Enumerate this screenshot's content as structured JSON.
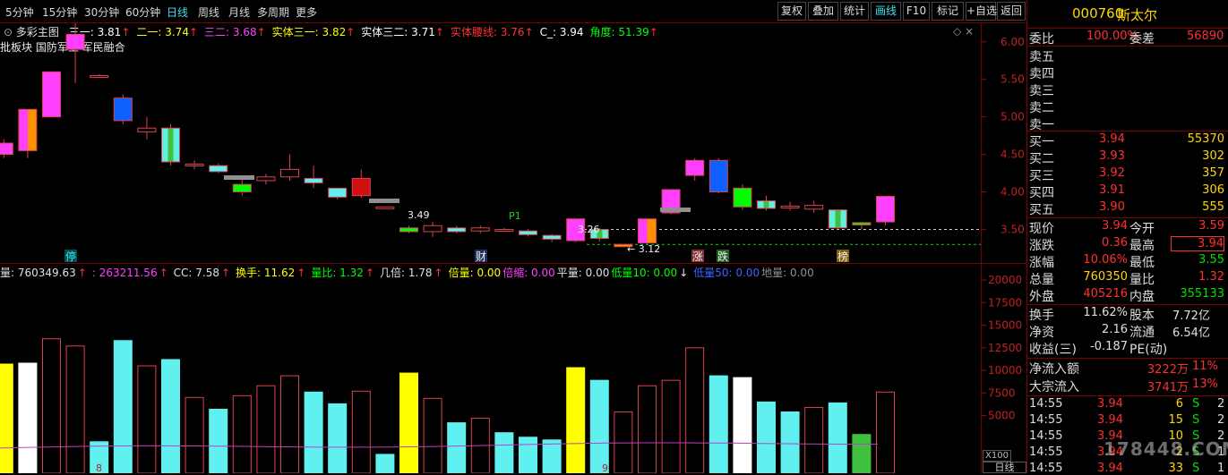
{
  "toolbar": {
    "periods": [
      "5分钟",
      "15分钟",
      "30分钟",
      "60分钟",
      "日线",
      "周线",
      "月线",
      "多周期",
      "更多"
    ],
    "active": "日线",
    "right_buttons": [
      "复权",
      "叠加",
      "统计",
      "画线",
      "F10",
      "标记",
      "+自选",
      "返回"
    ],
    "active_right": "画线"
  },
  "main_legend": {
    "title": "多彩主图",
    "items": [
      {
        "label": "三一: 3.81",
        "arrow": "↑",
        "color": "#ffffff"
      },
      {
        "label": "二一: 3.74",
        "arrow": "↑",
        "color": "#ffff00"
      },
      {
        "label": "三二: 3.68",
        "arrow": "↑",
        "color": "#ff40ff"
      },
      {
        "label": "实体三一: 3.82",
        "arrow": "↑",
        "color": "#ffff00"
      },
      {
        "label": "实体三二: 3.71",
        "arrow": "↑",
        "color": "#ffffff"
      },
      {
        "label": "实体腰线: 3.76",
        "arrow": "↑",
        "color": "#ff3030"
      },
      {
        "label": "C_: 3.94",
        "arrow": "",
        "color": "#ffffff"
      },
      {
        "label": "角度: 51.39",
        "arrow": "↑",
        "color": "#00ff00"
      }
    ],
    "sub": "批板块  国防军工  军民融合"
  },
  "price_axis": [
    "6.00",
    "5.50",
    "5.00",
    "4.50",
    "4.00",
    "3.50"
  ],
  "volume_axis": [
    "20000",
    "17500",
    "15000",
    "12500",
    "10000",
    "7500",
    "5000"
  ],
  "volume_legend": [
    {
      "t": "量: 760349.63",
      "c": "#e0e0e0"
    },
    {
      "t": "↑",
      "c": "#ff3030"
    },
    {
      "t": ": 263211.56",
      "c": "#ff40ff"
    },
    {
      "t": "↑",
      "c": "#ff3030"
    },
    {
      "t": "CC: 7.58",
      "c": "#e0e0e0"
    },
    {
      "t": "↑",
      "c": "#ff3030"
    },
    {
      "t": "换手: 11.62",
      "c": "#ffff00"
    },
    {
      "t": "↑",
      "c": "#ff3030"
    },
    {
      "t": "量比: 1.32",
      "c": "#00ff00"
    },
    {
      "t": "↑",
      "c": "#ff3030"
    },
    {
      "t": "几倍: 1.78",
      "c": "#e0e0e0"
    },
    {
      "t": "↑",
      "c": "#ff3030"
    },
    {
      "t": "倍量: 0.00",
      "c": "#ffff00"
    },
    {
      "t": "倍缩: 0.00",
      "c": "#ff40ff"
    },
    {
      "t": "平量: 0.00",
      "c": "#e0e0e0"
    },
    {
      "t": "低量10: 0.00",
      "c": "#00ff00"
    },
    {
      "t": "↓",
      "c": "#e0e0e0"
    },
    {
      "t": "低量50: 0.00",
      "c": "#4060ff"
    },
    {
      "t": "地量: 0.00",
      "c": "#909090"
    }
  ],
  "chart_labels": {
    "p349": "3.49",
    "p326": "3.26",
    "p312": "← 3.12",
    "p1": "P1",
    "marks": [
      "停",
      "财",
      "涨",
      "跌",
      "榜"
    ],
    "x100": "X100",
    "bottom_tab": "日线",
    "date_marks": [
      "8",
      "9"
    ]
  },
  "quote": {
    "code": "000760",
    "name": "斯太尔",
    "weibi_label": "委比",
    "weibi": "100.00%",
    "weicha_label": "委差",
    "weicha": "56890",
    "sells": [
      {
        "l": "卖五"
      },
      {
        "l": "卖四"
      },
      {
        "l": "卖三"
      },
      {
        "l": "卖二"
      },
      {
        "l": "卖一"
      }
    ],
    "buys": [
      {
        "l": "买一",
        "p": "3.94",
        "v": "55370"
      },
      {
        "l": "买二",
        "p": "3.93",
        "v": "302"
      },
      {
        "l": "买三",
        "p": "3.92",
        "v": "357"
      },
      {
        "l": "买四",
        "p": "3.91",
        "v": "306"
      },
      {
        "l": "买五",
        "p": "3.90",
        "v": "555"
      }
    ],
    "stats": [
      {
        "l1": "现价",
        "v1": "3.94",
        "c1": "#ff3030",
        "l2": "今开",
        "v2": "3.59",
        "c2": "#ff3030"
      },
      {
        "l1": "涨跌",
        "v1": "0.36",
        "c1": "#ff3030",
        "l2": "最高",
        "v2": "3.94",
        "c2": "#ff3030"
      },
      {
        "l1": "涨幅",
        "v1": "10.06%",
        "c1": "#ff3030",
        "l2": "最低",
        "v2": "3.55",
        "c2": "#00e000"
      },
      {
        "l1": "总量",
        "v1": "760350",
        "c1": "#ffd800",
        "l2": "量比",
        "v2": "1.32",
        "c2": "#ff3030"
      },
      {
        "l1": "外盘",
        "v1": "405216",
        "c1": "#ff3030",
        "l2": "内盘",
        "v2": "355133",
        "c2": "#00e000"
      }
    ],
    "stats2": [
      {
        "l1": "换手",
        "v1": "11.62%",
        "l2": "股本",
        "v2": "7.72亿"
      },
      {
        "l1": "净资",
        "v1": "2.16",
        "l2": "流通",
        "v2": "6.54亿"
      },
      {
        "l1": "收益(三)",
        "v1": "-0.187",
        "l2": "PE(动)",
        "v2": ""
      }
    ],
    "flows": [
      {
        "l": "净流入额",
        "v": "3222万",
        "p": "11%"
      },
      {
        "l": "大宗流入",
        "v": "3741万",
        "p": "13%"
      }
    ],
    "ticks": [
      {
        "t": "14:55",
        "p": "3.94",
        "v": "6",
        "s": "S",
        "n": "2"
      },
      {
        "t": "14:55",
        "p": "3.94",
        "v": "15",
        "s": "S",
        "n": "2"
      },
      {
        "t": "14:55",
        "p": "3.94",
        "v": "10",
        "s": "S",
        "n": "2"
      },
      {
        "t": "14:55",
        "p": "3.94",
        "v": "2",
        "s": "S",
        "n": "1"
      },
      {
        "t": "14:55",
        "p": "3.94",
        "v": "33",
        "s": "S",
        "n": "1"
      }
    ]
  },
  "watermark": "178448.COM",
  "chart_data": {
    "type": "candlestick",
    "ylim": [
      3.1,
      6.2
    ],
    "candles": [
      {
        "o": 4.5,
        "c": 4.65,
        "h": 4.7,
        "l": 4.45,
        "f": "#ff40ff"
      },
      {
        "o": 4.55,
        "c": 5.1,
        "h": 5.1,
        "l": 4.45,
        "f": "grad"
      },
      {
        "o": 5.0,
        "c": 5.6,
        "h": 5.6,
        "l": 5.0,
        "f": "#ff40ff"
      },
      {
        "o": 5.9,
        "c": 6.1,
        "h": 6.25,
        "l": 5.45,
        "f": "#ff40ff"
      },
      {
        "o": 5.55,
        "c": 5.55,
        "h": 5.57,
        "l": 5.53,
        "f": "none"
      },
      {
        "o": 5.25,
        "c": 4.95,
        "h": 5.3,
        "l": 4.9,
        "f": "#1060ff"
      },
      {
        "o": 4.8,
        "c": 4.85,
        "h": 5.0,
        "l": 4.7,
        "f": "none"
      },
      {
        "o": 4.85,
        "c": 4.4,
        "h": 4.9,
        "l": 4.35,
        "f": "grad2"
      },
      {
        "o": 4.35,
        "c": 4.37,
        "h": 4.42,
        "l": 4.3,
        "f": "none"
      },
      {
        "o": 4.35,
        "c": 4.27,
        "h": 4.38,
        "l": 4.25,
        "f": "cyan"
      },
      {
        "o": 4.1,
        "c": 4.0,
        "h": 4.2,
        "l": 3.95,
        "f": "#00ff00"
      },
      {
        "o": 4.2,
        "c": 4.15,
        "h": 4.24,
        "l": 4.1,
        "f": "none"
      },
      {
        "o": 4.2,
        "c": 4.3,
        "h": 4.5,
        "l": 4.15,
        "f": "none"
      },
      {
        "o": 4.18,
        "c": 4.12,
        "h": 4.35,
        "l": 4.05,
        "f": "cyan"
      },
      {
        "o": 4.05,
        "c": 3.93,
        "h": 4.05,
        "l": 3.9,
        "f": "cyan"
      },
      {
        "o": 4.18,
        "c": 3.95,
        "h": 4.3,
        "l": 3.92,
        "f": "#d01010"
      },
      {
        "o": 3.8,
        "c": 3.8,
        "h": 3.8,
        "l": 3.8,
        "f": "none"
      },
      {
        "o": 3.52,
        "c": 3.47,
        "h": 3.55,
        "l": 3.45,
        "f": "#00ff00"
      },
      {
        "o": 3.55,
        "c": 3.47,
        "h": 3.6,
        "l": 3.4,
        "f": "none"
      },
      {
        "o": 3.52,
        "c": 3.47,
        "h": 3.55,
        "l": 3.45,
        "f": "cyan"
      },
      {
        "o": 3.52,
        "c": 3.48,
        "h": 3.55,
        "l": 3.45,
        "f": "none"
      },
      {
        "o": 3.5,
        "c": 3.5,
        "h": 3.52,
        "l": 3.48,
        "f": "none"
      },
      {
        "o": 3.48,
        "c": 3.43,
        "h": 3.5,
        "l": 3.41,
        "f": "cyan"
      },
      {
        "o": 3.42,
        "c": 3.37,
        "h": 3.44,
        "l": 3.33,
        "f": "cyan"
      },
      {
        "o": 3.35,
        "c": 3.64,
        "h": 3.64,
        "l": 3.33,
        "f": "#ff40ff"
      },
      {
        "o": 3.5,
        "c": 3.38,
        "h": 3.52,
        "l": 3.34,
        "f": "grad2"
      },
      {
        "o": 3.3,
        "c": 3.27,
        "h": 3.3,
        "l": 3.27,
        "f": "#ff9000"
      },
      {
        "o": 3.32,
        "c": 3.64,
        "h": 3.64,
        "l": 3.3,
        "f": "grad"
      },
      {
        "o": 3.72,
        "c": 4.03,
        "h": 4.03,
        "l": 3.7,
        "f": "#ff40ff"
      },
      {
        "o": 4.22,
        "c": 4.42,
        "h": 4.45,
        "l": 4.15,
        "f": "#ff40ff"
      },
      {
        "o": 4.0,
        "c": 4.42,
        "h": 4.45,
        "l": 3.98,
        "f": "#1060ff"
      },
      {
        "o": 4.05,
        "c": 3.8,
        "h": 4.1,
        "l": 3.76,
        "f": "#00ff00"
      },
      {
        "o": 3.88,
        "c": 3.78,
        "h": 3.95,
        "l": 3.75,
        "f": "grad2"
      },
      {
        "o": 3.8,
        "c": 3.81,
        "h": 3.87,
        "l": 3.75,
        "f": "none"
      },
      {
        "o": 3.82,
        "c": 3.77,
        "h": 3.88,
        "l": 3.72,
        "f": "none"
      },
      {
        "o": 3.76,
        "c": 3.52,
        "h": 3.77,
        "l": 3.5,
        "f": "grad2"
      },
      {
        "o": 3.56,
        "c": 3.59,
        "h": 3.6,
        "l": 3.5,
        "f": "#00ff00"
      },
      {
        "o": 3.6,
        "c": 3.94,
        "h": 3.94,
        "l": 3.55,
        "f": "#ff40ff"
      }
    ],
    "volumes": [
      {
        "v": 10700,
        "f": "#ffff00"
      },
      {
        "v": 10800,
        "f": "#ffffff"
      },
      {
        "v": 13500,
        "f": "none"
      },
      {
        "v": 12700,
        "f": "none"
      },
      {
        "v": 2100,
        "f": "cyan"
      },
      {
        "v": 13300,
        "f": "cyan"
      },
      {
        "v": 10500,
        "f": "none"
      },
      {
        "v": 11200,
        "f": "cyan"
      },
      {
        "v": 7000,
        "f": "none"
      },
      {
        "v": 5700,
        "f": "cyan"
      },
      {
        "v": 7200,
        "f": "none"
      },
      {
        "v": 8300,
        "f": "none"
      },
      {
        "v": 9400,
        "f": "none"
      },
      {
        "v": 7600,
        "f": "cyan"
      },
      {
        "v": 6300,
        "f": "cyan"
      },
      {
        "v": 7700,
        "f": "none"
      },
      {
        "v": 700,
        "f": "cyan"
      },
      {
        "v": 9700,
        "f": "#ffff00"
      },
      {
        "v": 6900,
        "f": "none"
      },
      {
        "v": 4200,
        "f": "cyan"
      },
      {
        "v": 4700,
        "f": "none"
      },
      {
        "v": 3100,
        "f": "cyan"
      },
      {
        "v": 2600,
        "f": "cyan"
      },
      {
        "v": 2300,
        "f": "cyan"
      },
      {
        "v": 10300,
        "f": "#ffff00"
      },
      {
        "v": 8900,
        "f": "cyan"
      },
      {
        "v": 5400,
        "f": "none"
      },
      {
        "v": 8300,
        "f": "none"
      },
      {
        "v": 8900,
        "f": "none"
      },
      {
        "v": 12500,
        "f": "none"
      },
      {
        "v": 9400,
        "f": "cyan"
      },
      {
        "v": 9200,
        "f": "#ffffff"
      },
      {
        "v": 6500,
        "f": "cyan"
      },
      {
        "v": 5400,
        "f": "cyan"
      },
      {
        "v": 5900,
        "f": "none"
      },
      {
        "v": 6400,
        "f": "cyan"
      },
      {
        "v": 2900,
        "f": "#40c040"
      },
      {
        "v": 7600,
        "f": "none"
      }
    ],
    "vol_ylim": [
      0,
      21000
    ]
  }
}
